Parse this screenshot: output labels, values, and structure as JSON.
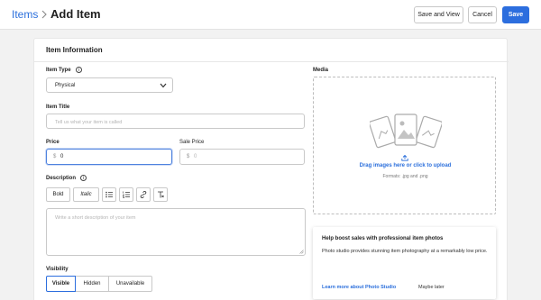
{
  "header": {
    "breadcrumb": "Items",
    "title": "Add Item",
    "save_and_view": "Save and View",
    "cancel": "Cancel",
    "save": "Save"
  },
  "section": {
    "title": "Item Information"
  },
  "item_type": {
    "label": "Item Type",
    "value": "Physical"
  },
  "item_title": {
    "label": "Item Title",
    "placeholder": "Tell us what your item is called"
  },
  "price": {
    "label": "Price",
    "currency": "$",
    "value": "0"
  },
  "sale_price": {
    "label": "Sale Price",
    "currency": "$",
    "placeholder": "0"
  },
  "description": {
    "label": "Description",
    "placeholder": "Write a short description of your item",
    "toolbar": {
      "bold": "Bold",
      "italic": "Italic"
    }
  },
  "visibility": {
    "label": "Visibility",
    "options": [
      "Visible",
      "Hidden",
      "Unavailable"
    ],
    "selected": "Visible"
  },
  "media": {
    "label": "Media",
    "drag_text": "Drag images here or click to upload",
    "formats": "Formats: .jpg and .png"
  },
  "promo": {
    "title": "Help boost sales with professional item photos",
    "body": "Photo studio provides stunning item photography at a remarkably low price.",
    "learn_more": "Learn more about Photo Studio",
    "dismiss": "Maybe later"
  },
  "colors": {
    "accent": "#2c6ede",
    "link": "#2b6fdc",
    "background": "#f2f2f2"
  },
  "icons": {
    "breadcrumb_separator": "chevron-right-icon",
    "dropdown": "chevron-down-icon",
    "upload": "upload-icon",
    "info": "info-icon"
  }
}
